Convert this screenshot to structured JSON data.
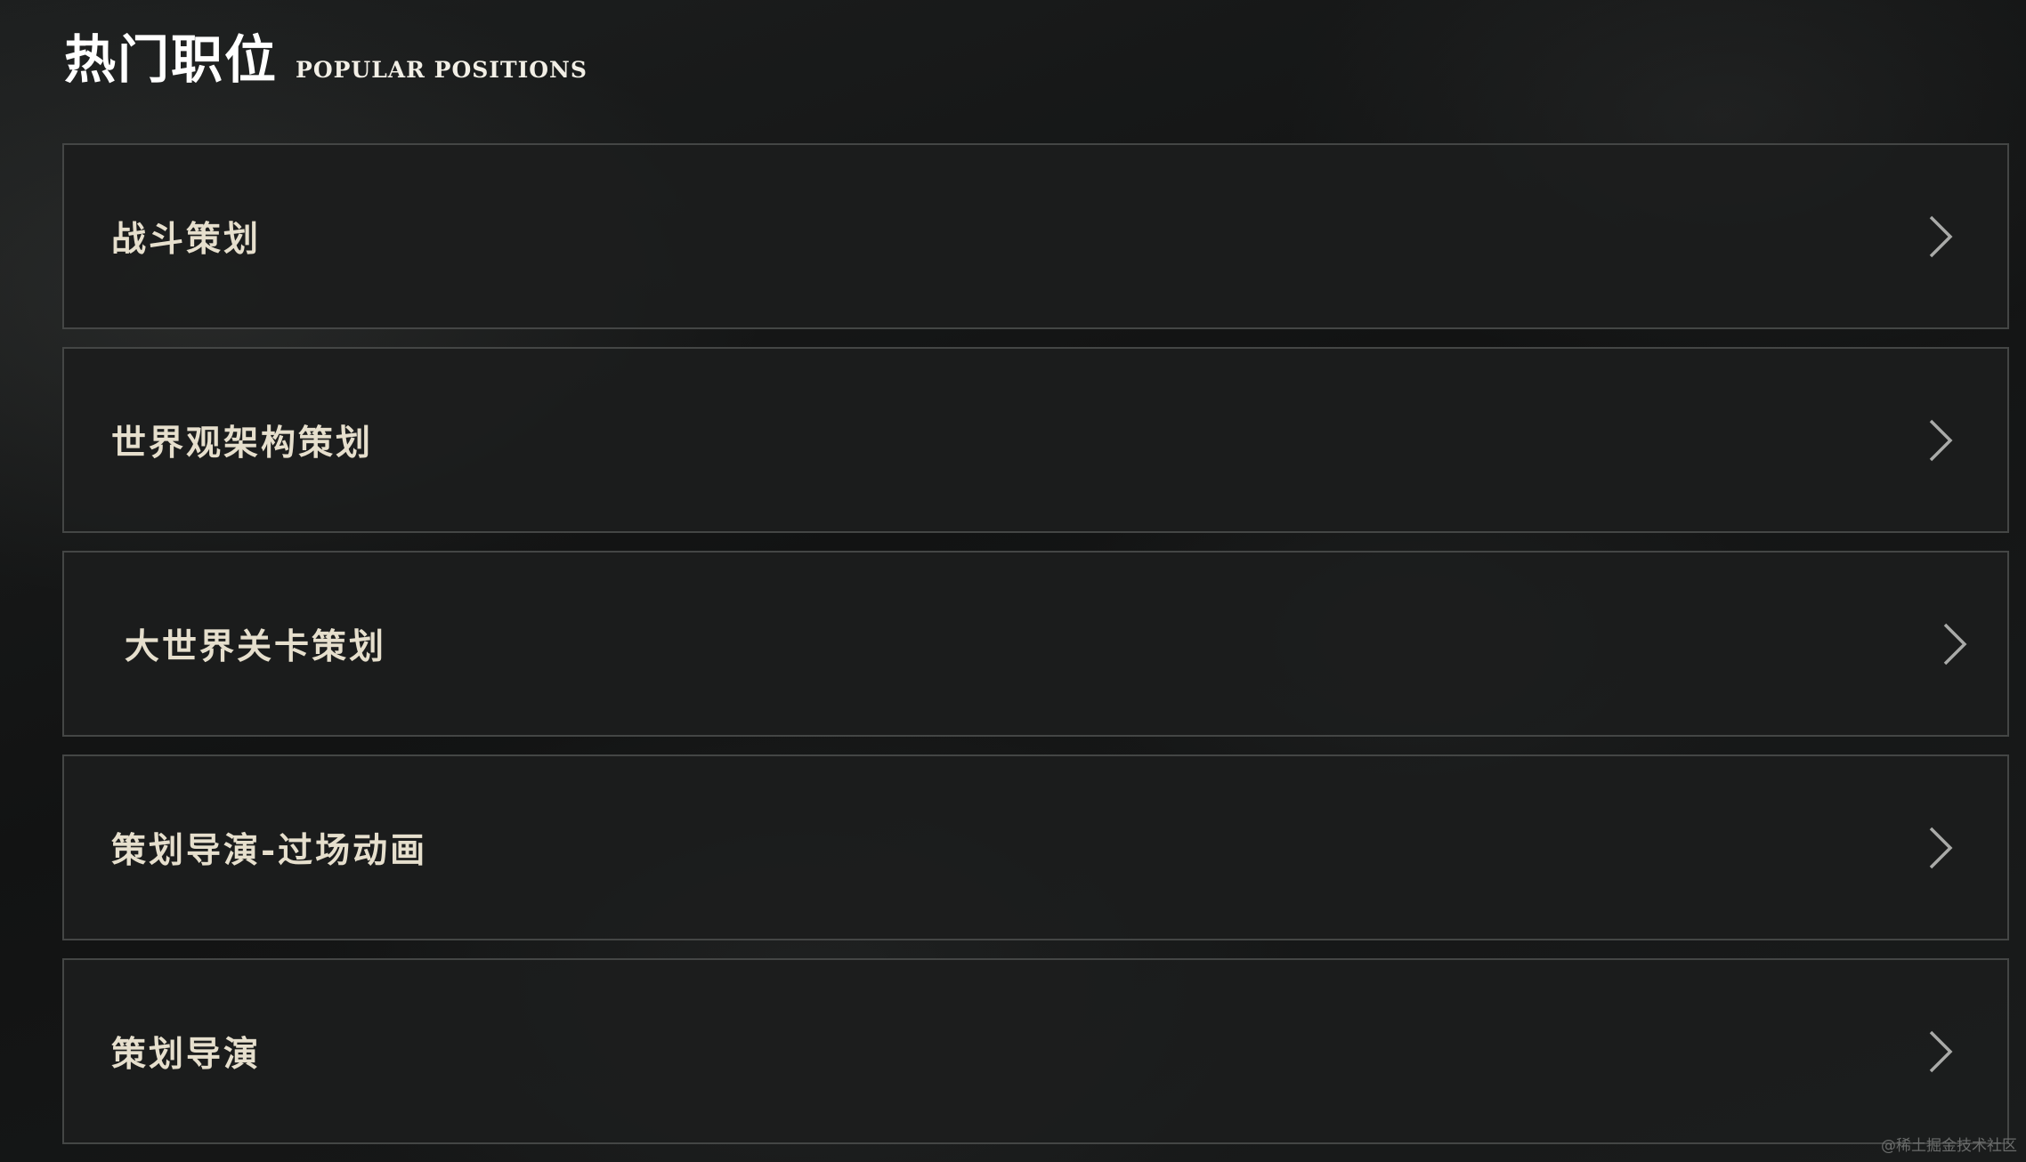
{
  "header": {
    "title": "热门职位",
    "subtitle": "POPULAR POSITIONS"
  },
  "positions": [
    {
      "label": "战斗策划",
      "icon": "chevron-right-icon"
    },
    {
      "label": "世界观架构策划",
      "icon": "chevron-right-icon"
    },
    {
      "label": "大世界关卡策划",
      "icon": "chevron-right-icon"
    },
    {
      "label": "策划导演-过场动画",
      "icon": "chevron-right-icon"
    },
    {
      "label": "策划导演",
      "icon": "chevron-right-icon"
    }
  ],
  "watermark": "@稀土掘金技术社区",
  "colors": {
    "background": "#151616",
    "row_bg": "#1c1d1d",
    "row_border": "#444645",
    "label_text": "#e6dfcd",
    "chevron": "#a9aaa8"
  }
}
